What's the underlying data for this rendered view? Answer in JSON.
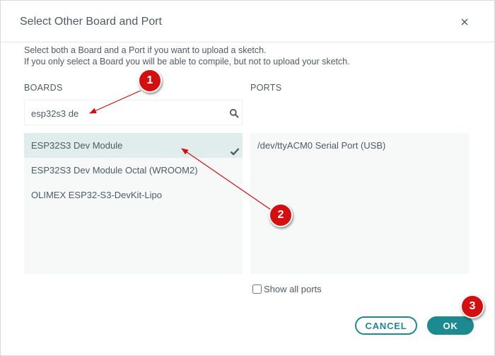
{
  "dialog": {
    "title": "Select Other Board and Port",
    "close_icon": "close-icon",
    "description_line1": "Select both a Board and a Port if you want to upload a sketch.",
    "description_line2": "If you only select a Board you will be able to compile, but not to upload your sketch."
  },
  "boards": {
    "label": "BOARDS",
    "search_value": "esp32s3 de",
    "search_icon": "search-icon",
    "items": [
      {
        "label": "ESP32S3 Dev Module",
        "selected": true
      },
      {
        "label": "ESP32S3 Dev Module Octal (WROOM2)",
        "selected": false
      },
      {
        "label": "OLIMEX ESP32-S3-DevKit-Lipo",
        "selected": false
      }
    ],
    "check_icon": "checkmark-icon"
  },
  "ports": {
    "label": "PORTS",
    "items": [
      {
        "label": "/dev/ttyACM0 Serial Port (USB)"
      }
    ],
    "show_all_label": "Show all ports",
    "show_all_checked": false
  },
  "buttons": {
    "cancel_label": "CANCEL",
    "ok_label": "OK"
  },
  "annotations": {
    "markers": [
      "1",
      "2",
      "3"
    ]
  },
  "colors": {
    "accent": "#1c8b8f",
    "selected_row": "#e1ecec",
    "panel_bg": "#f7f9f9",
    "annotation_red": "#d40f10",
    "text": "#4e5b61"
  }
}
